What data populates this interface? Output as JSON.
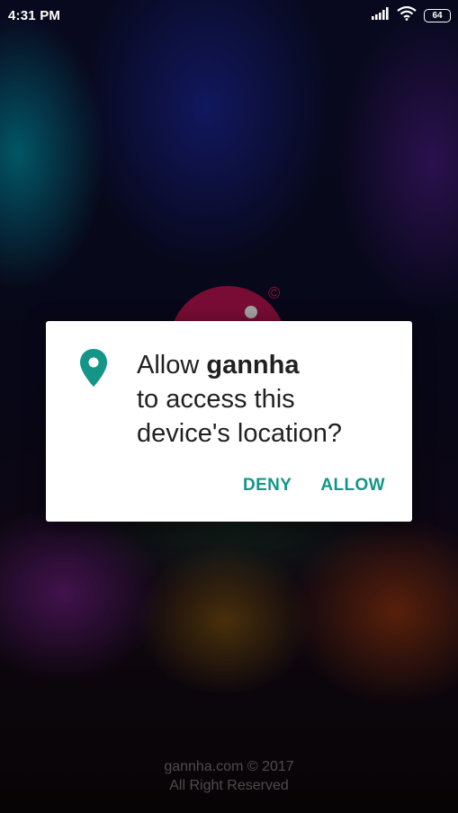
{
  "status_bar": {
    "time": "4:31 PM",
    "battery_level": "64",
    "icons": [
      "signal-icon",
      "wifi-icon",
      "battery-icon"
    ]
  },
  "splash": {
    "logo_mark": "©",
    "footer_line1": "gannha.com © 2017",
    "footer_line2": "All Right Reserved"
  },
  "dialog": {
    "icon": "location-pin-icon",
    "message_prefix": "Allow ",
    "app_name": "gannha",
    "message_line2": "to access this",
    "message_line3": "device's location?",
    "deny_label": "DENY",
    "allow_label": "ALLOW",
    "accent_color": "#139688"
  }
}
